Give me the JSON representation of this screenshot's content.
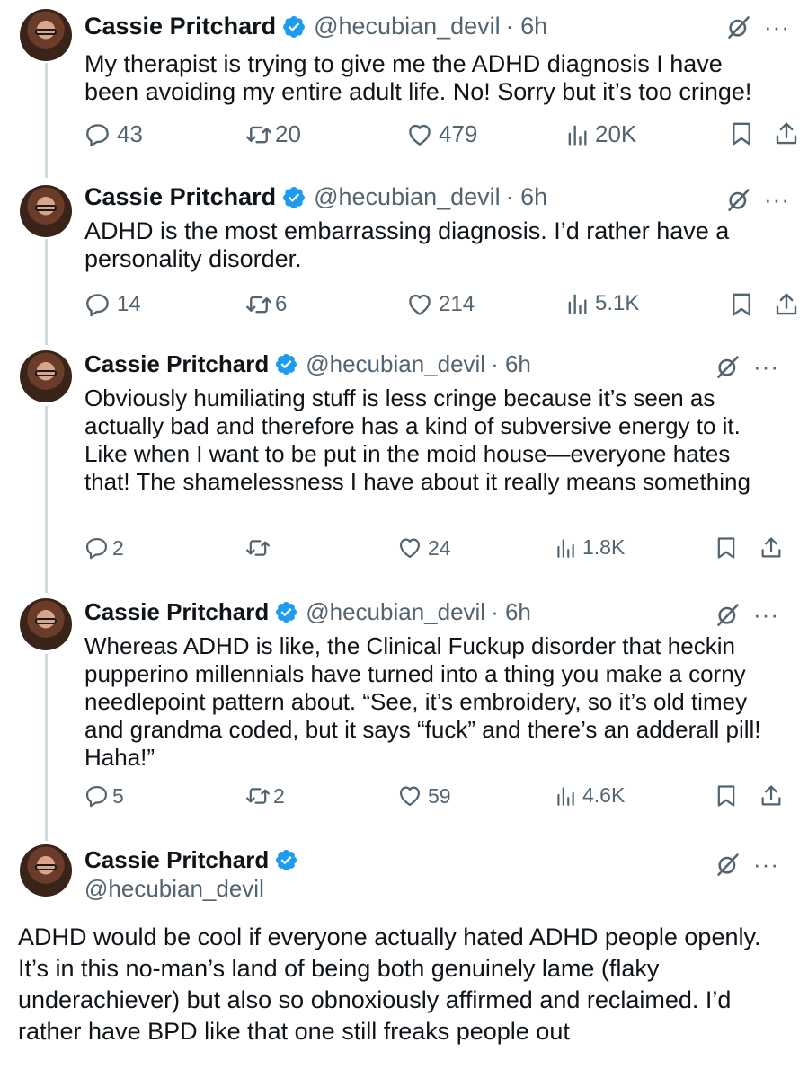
{
  "tweets": [
    {
      "name": "Cassie Pritchard",
      "handle": "@hecubian_devil",
      "time": "· 6h",
      "text": "My therapist is trying to give me the ADHD diagnosis I have been avoiding my entire adult life. No! Sorry but it’s too cringe!",
      "replies": "43",
      "retweets": "20",
      "likes": "479",
      "views": "20K"
    },
    {
      "name": "Cassie Pritchard",
      "handle": "@hecubian_devil",
      "time": "· 6h",
      "text": "ADHD is the most embarrassing diagnosis. I’d rather have a personality disorder.",
      "replies": "14",
      "retweets": "6",
      "likes": "214",
      "views": "5.1K"
    },
    {
      "name": "Cassie Pritchard",
      "handle": "@hecubian_devil",
      "time": "· 6h",
      "text": "Obviously humiliating stuff is less cringe because it’s seen as actually bad and therefore has a kind of subversive energy to it. Like when I want to be put in the moid house—everyone hates that! The shamelessness I have about it really means something",
      "replies": "2",
      "retweets": "",
      "likes": "24",
      "views": "1.8K"
    },
    {
      "name": "Cassie Pritchard",
      "handle": "@hecubian_devil",
      "time": "· 6h",
      "text": "Whereas ADHD is like, the Clinical Fuckup disorder that heckin pupperino millennials have turned into a thing you make a corny needlepoint pattern about. “See, it’s embroidery, so it’s old timey and grandma coded, but it says “fuck” and there’s an adderall pill! Haha!”",
      "replies": "5",
      "retweets": "2",
      "likes": "59",
      "views": "4.6K"
    }
  ],
  "main_tweet": {
    "name": "Cassie Pritchard",
    "handle": "@hecubian_devil",
    "text": "ADHD would be cool if everyone actually hated ADHD people openly. It’s in this no-man’s land of being both genuinely lame (flaky underachiever) but also so obnoxiously affirmed and reclaimed. I’d rather have BPD like that one still freaks people out"
  },
  "icons": {
    "verified": "verified-badge-icon",
    "grok": "grok-icon",
    "more": "more-icon",
    "reply": "reply-icon",
    "retweet": "retweet-icon",
    "like": "like-icon",
    "views": "views-icon",
    "bookmark": "bookmark-icon",
    "share": "share-icon"
  },
  "colors": {
    "text": "#0f1419",
    "secondary": "#536471",
    "verified": "#1d9bf0",
    "thread_line": "#cfd9de"
  }
}
